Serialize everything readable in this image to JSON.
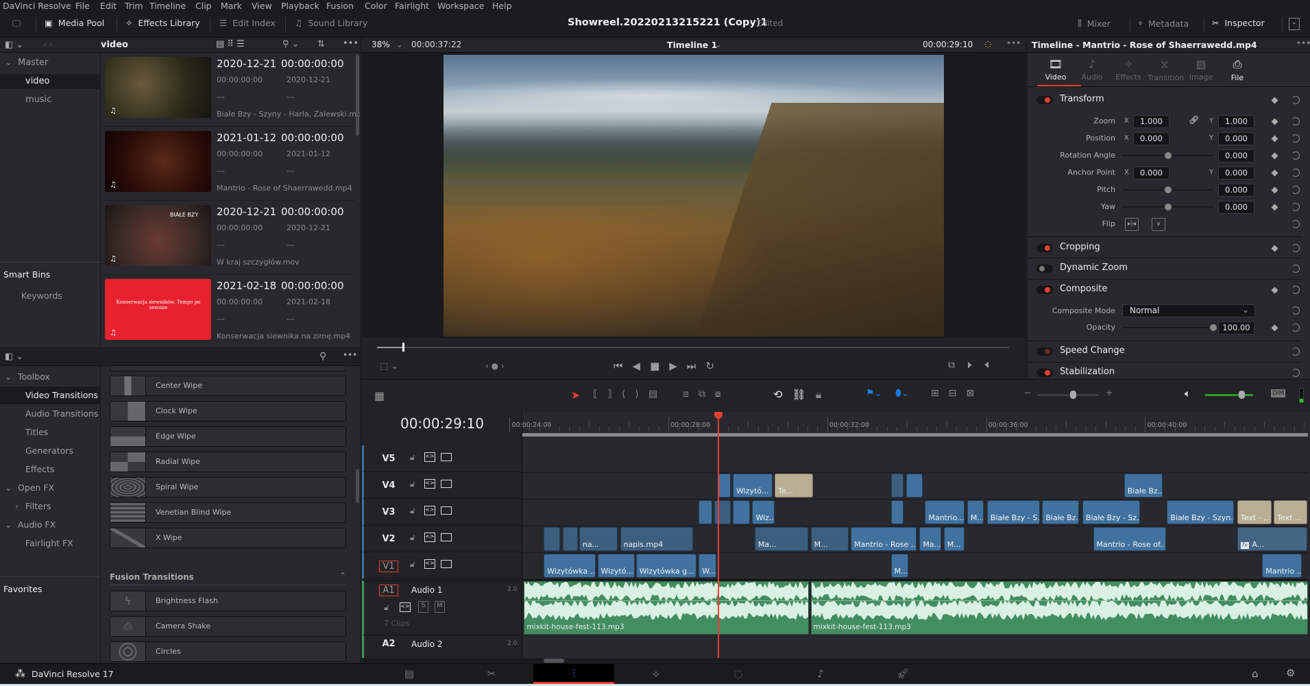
{
  "menu": [
    "DaVinci Resolve",
    "File",
    "Edit",
    "Trim",
    "Timeline",
    "Clip",
    "Mark",
    "View",
    "Playback",
    "Fusion",
    "Color",
    "Fairlight",
    "Workspace",
    "Help"
  ],
  "toolbar": {
    "media_pool": "Media Pool",
    "effects_library": "Effects Library",
    "edit_index": "Edit Index",
    "sound_library": "Sound Library",
    "project_title": "Showreel.20220213215221 (Copy)1",
    "status": "Edited",
    "mixer": "Mixer",
    "metadata": "Metadata",
    "inspector": "Inspector"
  },
  "media_pool": {
    "current_bin": "video",
    "bins": [
      {
        "label": "Master"
      },
      {
        "label": "video"
      },
      {
        "label": "music"
      }
    ],
    "smart_bins_title": "Smart Bins",
    "smart_bins": [
      {
        "label": "Keywords"
      }
    ],
    "clips": [
      {
        "date": "2020-12-21",
        "timecode": "00:00:00:00",
        "start_tc": "00:00:00:00",
        "date2": "2020-12-21",
        "f1": "---",
        "f2": "---",
        "name": "Białe Bzy - Szyny - Harla, Zalewski.mov",
        "thumb": "drummer"
      },
      {
        "date": "2021-01-12",
        "timecode": "00:00:00:00",
        "start_tc": "00:00:00:00",
        "date2": "2021-01-12",
        "f1": "---",
        "f2": "---",
        "name": "Mantrio - Rose of Shaerrawedd.mp4",
        "thumb": "singer"
      },
      {
        "date": "2020-12-21",
        "timecode": "00:00:00:00",
        "start_tc": "00:00:00:00",
        "date2": "2020-12-21",
        "f1": "---",
        "f2": "---",
        "name": "W kraj szczygłów.mov",
        "thumb": "band",
        "overlay": "BIAŁE BZY"
      },
      {
        "date": "2021-02-18",
        "timecode": "00:00:00:00",
        "start_tc": "00:00:00:00",
        "date2": "2021-02-18",
        "f1": "---",
        "f2": "---",
        "name": "Konserwacja siewnika na zimę.mp4",
        "thumb": "red",
        "overlay": "Konserwacja siewników. Tempo po sezonie"
      }
    ]
  },
  "viewer": {
    "zoom": "38%",
    "source_tc": "00:00:37:22",
    "timeline_name": "Timeline 1",
    "timeline_tc": "00:00:29:10",
    "scrub_position": 0.04
  },
  "effects": {
    "sidebar": [
      {
        "label": "Toolbox",
        "type": "group"
      },
      {
        "label": "Video Transitions",
        "type": "sel"
      },
      {
        "label": "Audio Transitions"
      },
      {
        "label": "Titles"
      },
      {
        "label": "Generators"
      },
      {
        "label": "Effects"
      },
      {
        "label": "Open FX",
        "type": "group"
      },
      {
        "label": "Filters",
        "type": "sub"
      },
      {
        "label": "Audio FX",
        "type": "group"
      },
      {
        "label": "Fairlight FX"
      }
    ],
    "favorites": "Favorites",
    "video_transitions": [
      {
        "label": "Center Wipe",
        "icon": "center-wipe"
      },
      {
        "label": "Clock Wipe",
        "icon": "clock-wipe"
      },
      {
        "label": "Edge Wipe",
        "icon": "edge-wipe"
      },
      {
        "label": "Radial Wipe",
        "icon": "radial-wipe"
      },
      {
        "label": "Spiral Wipe",
        "icon": "spiral-wipe"
      },
      {
        "label": "Venetian Blind Wipe",
        "icon": "venetian-blind-wipe"
      },
      {
        "label": "X Wipe",
        "icon": "x-wipe"
      }
    ],
    "fusion_title": "Fusion Transitions",
    "fusion_transitions": [
      {
        "label": "Brightness Flash",
        "icon": "lightning"
      },
      {
        "label": "Camera Shake",
        "icon": "camera"
      },
      {
        "label": "Circles",
        "icon": "circles"
      }
    ]
  },
  "inspector": {
    "title": "Timeline - Mantrio - Rose of Shaerrawedd.mp4",
    "tabs": [
      {
        "label": "Video",
        "active": true
      },
      {
        "label": "Audio"
      },
      {
        "label": "Effects"
      },
      {
        "label": "Transition"
      },
      {
        "label": "Image"
      },
      {
        "label": "File"
      }
    ],
    "transform": {
      "title": "Transform",
      "zoom_label": "Zoom",
      "zoom_x": "1.000",
      "zoom_y": "1.000",
      "position_label": "Position",
      "pos_x": "0.000",
      "pos_y": "0.000",
      "rotation_label": "Rotation Angle",
      "rotation": "0.000",
      "anchor_label": "Anchor Point",
      "anchor_x": "0.000",
      "anchor_y": "0.000",
      "pitch_label": "Pitch",
      "pitch": "0.000",
      "yaw_label": "Yaw",
      "yaw": "0.000",
      "flip_label": "Flip",
      "x": "X",
      "y": "Y"
    },
    "cropping": "Cropping",
    "dynamic_zoom": "Dynamic Zoom",
    "composite": {
      "title": "Composite",
      "mode_label": "Composite Mode",
      "mode": "Normal",
      "opacity_label": "Opacity",
      "opacity": "100.00"
    },
    "speed_change": "Speed Change",
    "stabilization": "Stabilization"
  },
  "timeline": {
    "timecode": "00:00:29:10",
    "visible_range_s": [
      24.32,
      44.1
    ],
    "playhead_s": 29.26,
    "ruler": [
      {
        "t": 24,
        "label": "00:00:24:00"
      },
      {
        "t": 28,
        "label": "00:00:28:00"
      },
      {
        "t": 32,
        "label": "00:00:32:00"
      },
      {
        "t": 36,
        "label": "00:00:36:00"
      },
      {
        "t": 40,
        "label": "00:00:40:00"
      }
    ],
    "video_tracks": [
      {
        "id": "V5"
      },
      {
        "id": "V4"
      },
      {
        "id": "V3"
      },
      {
        "id": "V2"
      },
      {
        "id": "V1",
        "selected": true
      }
    ],
    "audio_tracks": [
      {
        "id": "A1",
        "name": "Audio 1",
        "channels": "2.0",
        "clips_count": "7 Clips",
        "solo": "S",
        "mute": "M"
      },
      {
        "id": "A2",
        "name": "Audio 2",
        "channels": "2.0"
      }
    ],
    "clips": [
      {
        "track": "V4",
        "start": 29.26,
        "end": 29.58,
        "label": "",
        "color": "blue"
      },
      {
        "track": "V4",
        "start": 29.62,
        "end": 30.63,
        "label": "Wizytó...",
        "color": "blue"
      },
      {
        "track": "V4",
        "start": 30.67,
        "end": 31.66,
        "label": "Te...",
        "color": "tan"
      },
      {
        "track": "V4",
        "start": 33.6,
        "end": 33.94,
        "label": "",
        "color": "dark"
      },
      {
        "track": "V4",
        "start": 33.98,
        "end": 34.42,
        "label": "",
        "color": "blue"
      },
      {
        "track": "V4",
        "start": 39.47,
        "end": 40.46,
        "label": "Białe Bz...",
        "color": "blue"
      },
      {
        "track": "V3",
        "start": 28.76,
        "end": 29.12,
        "label": "",
        "color": "blue"
      },
      {
        "track": "V3",
        "start": 29.16,
        "end": 29.58,
        "label": "",
        "color": "dark"
      },
      {
        "track": "V3",
        "start": 29.62,
        "end": 30.06,
        "label": "",
        "color": "blue"
      },
      {
        "track": "V3",
        "start": 30.11,
        "end": 30.69,
        "label": "Wiz...",
        "color": "blue"
      },
      {
        "track": "V3",
        "start": 33.6,
        "end": 33.94,
        "label": "",
        "color": "blue"
      },
      {
        "track": "V3",
        "start": 34.46,
        "end": 35.47,
        "label": "Mantrio...",
        "color": "blue"
      },
      {
        "track": "V3",
        "start": 35.52,
        "end": 35.96,
        "label": "M...",
        "color": "blue"
      },
      {
        "track": "V3",
        "start": 36.02,
        "end": 37.37,
        "label": "Białe Bzy - S...",
        "color": "blue"
      },
      {
        "track": "V3",
        "start": 37.41,
        "end": 38.36,
        "label": "Białe Bz...",
        "color": "blue"
      },
      {
        "track": "V3",
        "start": 38.42,
        "end": 39.89,
        "label": "Białe Bzy - Sz...",
        "color": "blue"
      },
      {
        "track": "V3",
        "start": 40.55,
        "end": 42.25,
        "label": "Białe Bzy - Szyn...",
        "color": "blue"
      },
      {
        "track": "V3",
        "start": 42.32,
        "end": 43.2,
        "label": "Text - ...",
        "color": "tan"
      },
      {
        "track": "V3",
        "start": 43.24,
        "end": 44.1,
        "label": "Text ...",
        "color": "tan"
      },
      {
        "track": "V2",
        "start": 24.86,
        "end": 25.28,
        "label": "",
        "color": "dark"
      },
      {
        "track": "V2",
        "start": 25.33,
        "end": 25.73,
        "label": "",
        "color": "dark"
      },
      {
        "track": "V2",
        "start": 25.75,
        "end": 26.74,
        "label": "na...",
        "color": "dark"
      },
      {
        "track": "V2",
        "start": 26.78,
        "end": 28.63,
        "label": "napis.mp4",
        "color": "dark"
      },
      {
        "track": "V2",
        "start": 30.17,
        "end": 31.54,
        "label": "Ma...",
        "color": "dark"
      },
      {
        "track": "V2",
        "start": 31.58,
        "end": 32.55,
        "label": "M...",
        "color": "dark"
      },
      {
        "track": "V2",
        "start": 32.59,
        "end": 34.27,
        "label": "Mantrio - Rose ...",
        "color": "blue"
      },
      {
        "track": "V2",
        "start": 34.32,
        "end": 34.88,
        "label": "Ma...",
        "color": "blue"
      },
      {
        "track": "V2",
        "start": 34.93,
        "end": 35.47,
        "label": "M...",
        "color": "blue"
      },
      {
        "track": "V2",
        "start": 38.69,
        "end": 40.55,
        "label": "Mantrio - Rose of...",
        "color": "blue"
      },
      {
        "track": "V2",
        "start": 42.32,
        "end": 44.1,
        "label": "A...",
        "color": "gray",
        "fx": true
      },
      {
        "track": "V1",
        "start": 24.86,
        "end": 26.19,
        "label": "Wizytówka ...",
        "color": "blue"
      },
      {
        "track": "V1",
        "start": 26.21,
        "end": 27.16,
        "label": "Wizytó...",
        "color": "blue"
      },
      {
        "track": "V1",
        "start": 27.18,
        "end": 28.72,
        "label": "Wizytówka g...",
        "color": "blue"
      },
      {
        "track": "V1",
        "start": 28.76,
        "end": 29.22,
        "label": "W...",
        "color": "blue"
      },
      {
        "track": "V1",
        "start": 33.6,
        "end": 34.06,
        "label": "M...",
        "color": "blue"
      },
      {
        "track": "V1",
        "start": 42.95,
        "end": 43.96,
        "label": "Mantrio ...",
        "color": "blue"
      },
      {
        "track": "A1",
        "start": 24.36,
        "end": 31.54,
        "label": "mixkit-house-fest-113.mp3",
        "color": "green"
      },
      {
        "track": "A1",
        "start": 31.58,
        "end": 44.1,
        "label": "mixkit-house-fest-113.mp3",
        "color": "green"
      }
    ],
    "fx_badge": "fx"
  },
  "footer": {
    "app": "DaVinci Resolve 17",
    "pages": [
      "media",
      "cut",
      "edit",
      "fusion",
      "color",
      "fairlight",
      "deliver"
    ],
    "active_page": "edit"
  },
  "colors": {
    "accent": "#e8402f",
    "clip_blue": "#41729f",
    "clip_tan": "#b9ad93",
    "audio_green": "#438d62",
    "panel": "#28282e"
  }
}
